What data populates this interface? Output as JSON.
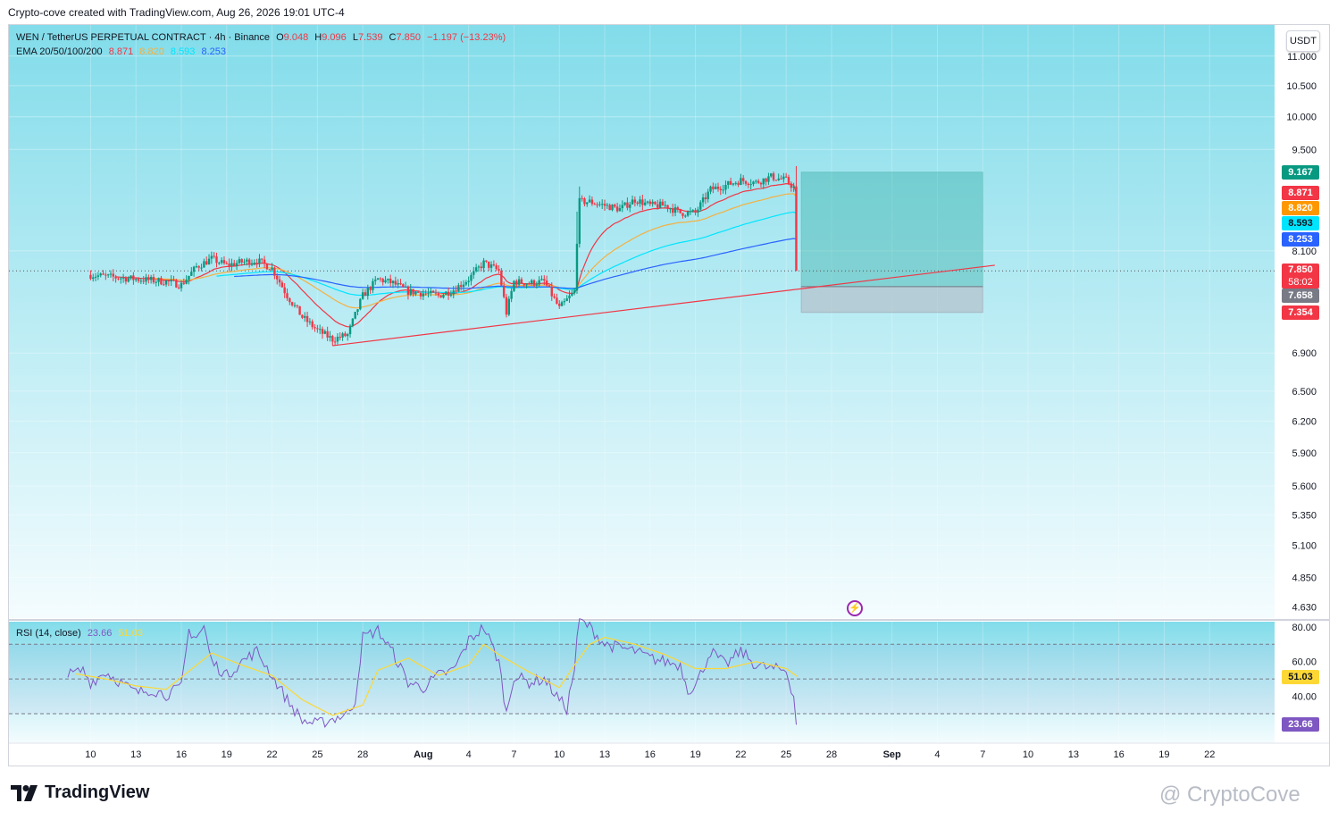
{
  "header": {
    "credit": "Crypto-cove created with TradingView.com, Aug 26, 2026 19:01 UTC-4"
  },
  "legend": {
    "symbol": "WEN / TetherUS PERPETUAL CONTRACT · 4h · Binance",
    "o_label": "O",
    "o": "9.048",
    "h_label": "H",
    "h": "9.096",
    "l_label": "L",
    "l": "7.539",
    "c_label": "C",
    "c": "7.850",
    "change": "−1.197 (−13.23%)",
    "ema_label": "EMA 20/50/100/200",
    "ema20": "8.871",
    "ema50": "8.820",
    "ema100": "8.593",
    "ema200": "8.253"
  },
  "rsi_legend": {
    "label": "RSI (14, close)",
    "rsi": "23.66",
    "ma": "51.03"
  },
  "currency_button": "USDT",
  "price_tags": [
    {
      "text": "9.167",
      "color": "#089981"
    },
    {
      "text": "8.871",
      "color": "#f23645"
    },
    {
      "text": "8.820",
      "color": "#ff9800"
    },
    {
      "text": "8.593",
      "color": "#00e5ff",
      "text_color": "#131722"
    },
    {
      "text": "8.253",
      "color": "#2962ff"
    },
    {
      "text": "7.850",
      "color": "#f23645",
      "sub": "58:02"
    },
    {
      "text": "7.658",
      "color": "#787b86"
    },
    {
      "text": "7.354",
      "color": "#f23645"
    }
  ],
  "rsi_tags": [
    {
      "text": "51.03",
      "color": "#fdd835",
      "text_color": "#131722"
    },
    {
      "text": "23.66",
      "color": "#7e57c2"
    }
  ],
  "colors": {
    "up": "#089981",
    "down": "#f23645",
    "ema20": "#f23645",
    "ema50": "#f5b041",
    "ema100": "#00e5ff",
    "ema200": "#2962ff",
    "rsi": "#7e57c2",
    "rsi_ma": "#fdd835",
    "trendline": "#f23645"
  },
  "footer": {
    "brand": "TradingView",
    "watermark": "@ CryptoCove"
  },
  "chart_data": [
    {
      "type": "candlestick",
      "title": "WEN / TetherUS PERPETUAL CONTRACT · 4h · Binance",
      "y_scale": "log",
      "ylim": [
        4.55,
        11.55
      ],
      "y_ticks": [
        "11.000",
        "10.500",
        "10.000",
        "9.500",
        "8.100",
        "6.900",
        "6.500",
        "6.200",
        "5.900",
        "5.600",
        "5.350",
        "5.100",
        "4.850",
        "4.630"
      ],
      "x_ticks": [
        "10",
        "13",
        "16",
        "19",
        "22",
        "25",
        "28",
        "Aug",
        "4",
        "7",
        "10",
        "13",
        "16",
        "19",
        "22",
        "25",
        "28",
        "Sep",
        "4",
        "7",
        "10",
        "13",
        "16",
        "19",
        "22"
      ],
      "x_tick_days": [
        10,
        13,
        16,
        19,
        22,
        25,
        28,
        32,
        35,
        38,
        41,
        44,
        47,
        50,
        53,
        56,
        59,
        63,
        66,
        69,
        72,
        75,
        78,
        81,
        84
      ],
      "x_range_days": [
        4.6,
        88.3
      ],
      "series_anchors": {
        "note": "approximate close values (day, price)",
        "close": [
          [
            10,
            7.8
          ],
          [
            11,
            7.78
          ],
          [
            13,
            7.75
          ],
          [
            15,
            7.72
          ],
          [
            16,
            7.68
          ],
          [
            17,
            7.9
          ],
          [
            18,
            8.0
          ],
          [
            19,
            7.92
          ],
          [
            20,
            7.96
          ],
          [
            21,
            7.98
          ],
          [
            22,
            7.88
          ],
          [
            23,
            7.55
          ],
          [
            24,
            7.3
          ],
          [
            25,
            7.15
          ],
          [
            26,
            7.05
          ],
          [
            27,
            7.1
          ],
          [
            28,
            7.55
          ],
          [
            29,
            7.75
          ],
          [
            30,
            7.7
          ],
          [
            31,
            7.6
          ],
          [
            32,
            7.58
          ],
          [
            33,
            7.55
          ],
          [
            34,
            7.62
          ],
          [
            35,
            7.75
          ],
          [
            36,
            7.95
          ],
          [
            37,
            7.85
          ],
          [
            37.5,
            7.35
          ],
          [
            38,
            7.72
          ],
          [
            39,
            7.7
          ],
          [
            40,
            7.72
          ],
          [
            41,
            7.4
          ],
          [
            42,
            7.6
          ],
          [
            42.3,
            8.75
          ],
          [
            43,
            8.75
          ],
          [
            44,
            8.7
          ],
          [
            45,
            8.65
          ],
          [
            46,
            8.78
          ],
          [
            47,
            8.7
          ],
          [
            48,
            8.7
          ],
          [
            49,
            8.6
          ],
          [
            50,
            8.6
          ],
          [
            51,
            8.92
          ],
          [
            52,
            8.98
          ],
          [
            53,
            9.05
          ],
          [
            54,
            9.02
          ],
          [
            55,
            9.1
          ],
          [
            56,
            9.05
          ],
          [
            56.5,
            8.95
          ],
          [
            56.8,
            7.85
          ]
        ]
      },
      "ema": {
        "ema20_last": 8.871,
        "ema50_last": 8.82,
        "ema100_last": 8.593,
        "ema200_last": 8.253
      },
      "trendline": {
        "from": [
          26,
          6.98
        ],
        "to": [
          69.8,
          7.92
        ]
      },
      "position_box": {
        "start_day": 57,
        "end_day": 69,
        "target": 9.167,
        "entry": 7.658,
        "stop": 7.354
      },
      "last_price": 7.85
    },
    {
      "type": "line",
      "title": "RSI (14, close)",
      "ylim": [
        13,
        83
      ],
      "y_ticks": [
        "80.00",
        "60.00",
        "40.00"
      ],
      "bands": [
        70,
        50,
        30
      ],
      "rsi_anchors": [
        [
          8.5,
          52
        ],
        [
          9.5,
          55
        ],
        [
          10,
          48
        ],
        [
          11,
          54
        ],
        [
          12,
          48
        ],
        [
          13,
          42
        ],
        [
          14,
          44
        ],
        [
          15,
          41
        ],
        [
          16,
          45
        ],
        [
          16.5,
          78
        ],
        [
          17,
          74
        ],
        [
          17.5,
          80
        ],
        [
          18,
          60
        ],
        [
          19,
          52
        ],
        [
          20,
          60
        ],
        [
          21,
          66
        ],
        [
          22,
          52
        ],
        [
          23,
          38
        ],
        [
          24,
          26
        ],
        [
          25,
          24
        ],
        [
          26,
          27
        ],
        [
          27,
          30
        ],
        [
          27.5,
          38
        ],
        [
          28,
          74
        ],
        [
          29,
          78
        ],
        [
          30,
          65
        ],
        [
          31,
          48
        ],
        [
          32,
          45
        ],
        [
          33,
          52
        ],
        [
          34,
          55
        ],
        [
          35,
          72
        ],
        [
          36,
          80
        ],
        [
          37,
          60
        ],
        [
          37.5,
          30
        ],
        [
          38,
          52
        ],
        [
          39,
          48
        ],
        [
          40,
          50
        ],
        [
          41,
          38
        ],
        [
          41.5,
          33
        ],
        [
          42,
          56
        ],
        [
          42.3,
          84
        ],
        [
          43,
          80
        ],
        [
          44,
          70
        ],
        [
          45,
          68
        ],
        [
          46,
          66
        ],
        [
          47,
          62
        ],
        [
          48,
          60
        ],
        [
          49,
          58
        ],
        [
          49.5,
          44
        ],
        [
          50,
          46
        ],
        [
          51,
          66
        ],
        [
          52,
          58
        ],
        [
          53,
          66
        ],
        [
          54,
          58
        ],
        [
          55,
          56
        ],
        [
          56,
          55
        ],
        [
          56.5,
          40
        ],
        [
          56.8,
          23.66
        ]
      ],
      "ma_anchors": [
        [
          9,
          53
        ],
        [
          11,
          50
        ],
        [
          13,
          46
        ],
        [
          15,
          44
        ],
        [
          17,
          58
        ],
        [
          18,
          65
        ],
        [
          20,
          58
        ],
        [
          22,
          52
        ],
        [
          24,
          38
        ],
        [
          26,
          29
        ],
        [
          28,
          35
        ],
        [
          29,
          55
        ],
        [
          31,
          62
        ],
        [
          33,
          52
        ],
        [
          35,
          58
        ],
        [
          36,
          70
        ],
        [
          37,
          64
        ],
        [
          39,
          54
        ],
        [
          41,
          45
        ],
        [
          42,
          58
        ],
        [
          43,
          70
        ],
        [
          44,
          74
        ],
        [
          46,
          70
        ],
        [
          48,
          64
        ],
        [
          50,
          56
        ],
        [
          52,
          56
        ],
        [
          54,
          60
        ],
        [
          56,
          56
        ],
        [
          56.8,
          51.03
        ]
      ],
      "last_rsi": 23.66,
      "last_ma": 51.03
    }
  ]
}
